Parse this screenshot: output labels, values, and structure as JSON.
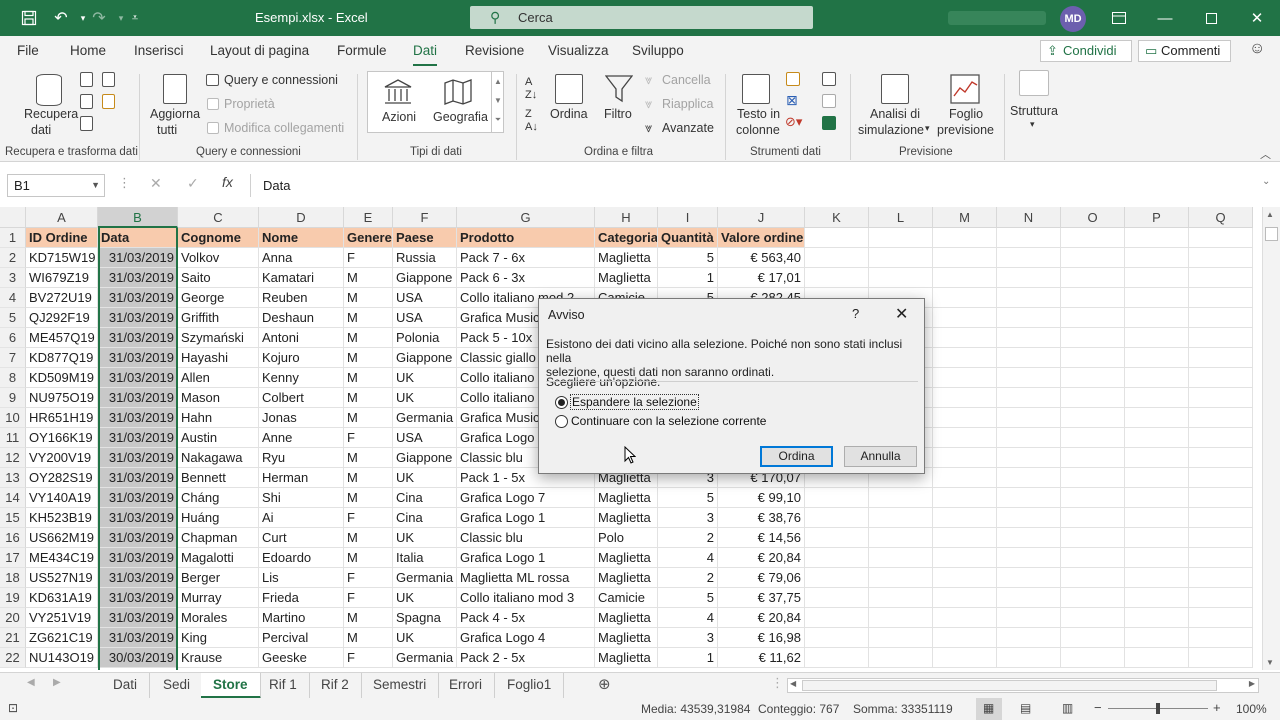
{
  "window": {
    "title": "Esempi.xlsx  -  Excel",
    "search_placeholder": "Cerca",
    "user_initials": "MD",
    "accent_color": "#217346"
  },
  "menu": {
    "tabs": [
      "File",
      "Home",
      "Inserisci",
      "Layout di pagina",
      "Formule",
      "Dati",
      "Revisione",
      "Visualizza",
      "Sviluppo"
    ],
    "active_tab": "Dati",
    "share_label": "Condividi",
    "comments_label": "Commenti"
  },
  "ribbon": {
    "recupera_label": "Recupera",
    "recupera_label2": "dati",
    "aggiorna_label": "Aggiorna",
    "aggiorna_label2": "tutti",
    "query_connessioni": "Query e connessioni",
    "proprieta": "Proprietà",
    "modifica_collegamenti": "Modifica collegamenti",
    "azioni": "Azioni",
    "geografia": "Geografia",
    "ordina": "Ordina",
    "filtro": "Filtro",
    "cancella": "Cancella",
    "riapplica": "Riapplica",
    "avanzate": "Avanzate",
    "testo_in": "Testo in",
    "colonne": "colonne",
    "analisi_di": "Analisi di",
    "simulazione": "simulazione",
    "foglio": "Foglio",
    "previsione": "previsione",
    "struttura": "Struttura",
    "groups": {
      "recupera": "Recupera e trasforma dati",
      "query": "Query e connessioni",
      "tipi": "Tipi di dati",
      "ordina": "Ordina e filtra",
      "strumenti": "Strumenti dati",
      "previsione": "Previsione"
    }
  },
  "formula_bar": {
    "name_box": "B1",
    "content": "Data"
  },
  "sheet": {
    "columns": [
      "A",
      "B",
      "C",
      "D",
      "E",
      "F",
      "G",
      "H",
      "I",
      "J",
      "K",
      "L",
      "M",
      "N",
      "O",
      "P",
      "Q"
    ],
    "selected_column": "B",
    "rows": [
      [
        "ID Ordine",
        "Data",
        "Cognome",
        "Nome",
        "Genere",
        "Paese",
        "Prodotto",
        "Categoria",
        "Quantità",
        "Valore ordine"
      ],
      [
        "KD715W19",
        "31/03/2019",
        "Volkov",
        "Anna",
        "F",
        "Russia",
        "Pack 7 - 6x",
        "Maglietta",
        "5",
        "€ 563,40"
      ],
      [
        "WI679Z19",
        "31/03/2019",
        "Saito",
        "Kamatari",
        "M",
        "Giappone",
        "Pack 6 - 3x",
        "Maglietta",
        "1",
        "€ 17,01"
      ],
      [
        "BV272U19",
        "31/03/2019",
        "George",
        "Reuben",
        "M",
        "USA",
        "Collo italiano mod 2",
        "Camicie",
        "5",
        "€ 282,45"
      ],
      [
        "QJ292F19",
        "31/03/2019",
        "Griffith",
        "Deshaun",
        "M",
        "USA",
        "Grafica Music",
        "",
        "",
        ""
      ],
      [
        "ME457Q19",
        "31/03/2019",
        "Szymański",
        "Antoni",
        "M",
        "Polonia",
        "Pack 5 - 10x",
        "",
        "",
        ""
      ],
      [
        "KD877Q19",
        "31/03/2019",
        "Hayashi",
        "Kojuro",
        "M",
        "Giappone",
        "Classic giallo",
        "",
        "",
        ""
      ],
      [
        "KD509M19",
        "31/03/2019",
        "Allen",
        "Kenny",
        "M",
        "UK",
        "Collo italiano",
        "",
        "",
        ""
      ],
      [
        "NU975O19",
        "31/03/2019",
        "Mason",
        "Colbert",
        "M",
        "UK",
        "Collo italiano",
        "",
        "",
        ""
      ],
      [
        "HR651H19",
        "31/03/2019",
        "Hahn",
        "Jonas",
        "M",
        "Germania",
        "Grafica Music",
        "",
        "",
        ""
      ],
      [
        "OY166K19",
        "31/03/2019",
        "Austin",
        "Anne",
        "F",
        "USA",
        "Grafica Logo",
        "",
        "",
        ""
      ],
      [
        "VY200V19",
        "31/03/2019",
        "Nakagawa",
        "Ryu",
        "M",
        "Giappone",
        "Classic blu",
        "",
        "",
        ""
      ],
      [
        "OY282S19",
        "31/03/2019",
        "Bennett",
        "Herman",
        "M",
        "UK",
        "Pack 1 - 5x",
        "Maglietta",
        "3",
        "€ 170,07"
      ],
      [
        "VY140A19",
        "31/03/2019",
        "Cháng",
        "Shi",
        "M",
        "Cina",
        "Grafica Logo 7",
        "Maglietta",
        "5",
        "€ 99,10"
      ],
      [
        "KH523B19",
        "31/03/2019",
        "Huáng",
        "Ai",
        "F",
        "Cina",
        "Grafica Logo 1",
        "Maglietta",
        "3",
        "€ 38,76"
      ],
      [
        "US662M19",
        "31/03/2019",
        "Chapman",
        "Curt",
        "M",
        "UK",
        "Classic blu",
        "Polo",
        "2",
        "€ 14,56"
      ],
      [
        "ME434C19",
        "31/03/2019",
        "Magalotti",
        "Edoardo",
        "M",
        "Italia",
        "Grafica Logo 1",
        "Maglietta",
        "4",
        "€ 20,84"
      ],
      [
        "US527N19",
        "31/03/2019",
        "Berger",
        "Lis",
        "F",
        "Germania",
        "Maglietta ML rossa",
        "Maglietta",
        "2",
        "€ 79,06"
      ],
      [
        "KD631A19",
        "31/03/2019",
        "Murray",
        "Frieda",
        "F",
        "UK",
        "Collo italiano mod 3",
        "Camicie",
        "5",
        "€ 37,75"
      ],
      [
        "VY251V19",
        "31/03/2019",
        "Morales",
        "Martino",
        "M",
        "Spagna",
        "Pack 4 - 5x",
        "Maglietta",
        "4",
        "€ 20,84"
      ],
      [
        "ZG621C19",
        "31/03/2019",
        "King",
        "Percival",
        "M",
        "UK",
        "Grafica Logo 4",
        "Maglietta",
        "3",
        "€ 16,98"
      ],
      [
        "NU143O19",
        "30/03/2019",
        "Krause",
        "Geeske",
        "F",
        "Germania",
        "Pack 2 - 5x",
        "Maglietta",
        "1",
        "€ 11,62"
      ]
    ]
  },
  "sheet_tabs": [
    "Dati",
    "Sedi",
    "Store",
    "Rif 1",
    "Rif 2",
    "Semestri",
    "Errori",
    "Foglio1"
  ],
  "active_sheet": "Store",
  "status": {
    "media": "Media: 43539,31984",
    "conteggio": "Conteggio: 767",
    "somma": "Somma: 33351119",
    "zoom": "100%"
  },
  "dialog": {
    "title": "Avviso",
    "help": "?",
    "message_line1": "Esistono dei dati vicino alla selezione. Poiché non sono stati inclusi nella",
    "message_line2": "selezione, questi dati non saranno ordinati.",
    "choose": "Scegliere un'opzione.",
    "option1": "Espandere la selezione",
    "option2": "Continuare con la selezione corrente",
    "ok": "Ordina",
    "cancel": "Annulla"
  }
}
